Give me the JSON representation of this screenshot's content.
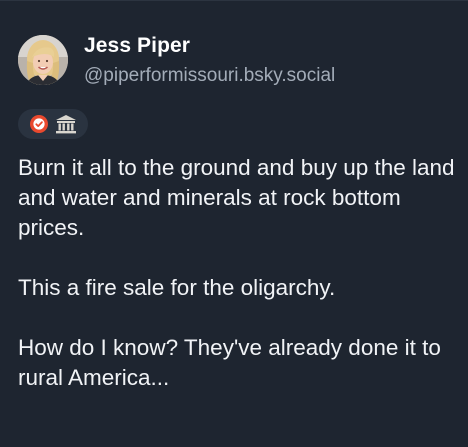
{
  "post": {
    "author": {
      "display_name": "Jess Piper",
      "handle": "@piperformissouri.bsky.social",
      "avatar_icon": "avatar-photo"
    },
    "badges": [
      {
        "icon": "verified-check-icon",
        "color": "#e9492e"
      },
      {
        "icon": "government-building-icon",
        "color": "#d9d6cf"
      }
    ],
    "paragraphs": [
      "Burn it all to the ground and buy up the land and water and minerals at rock bottom prices.",
      "This a fire sale for the oligarchy.",
      "How do I know? They've already done it to rural America..."
    ]
  },
  "colors": {
    "background": "#1e2530",
    "text": "#f1f3f6",
    "muted": "#a3acb8"
  }
}
